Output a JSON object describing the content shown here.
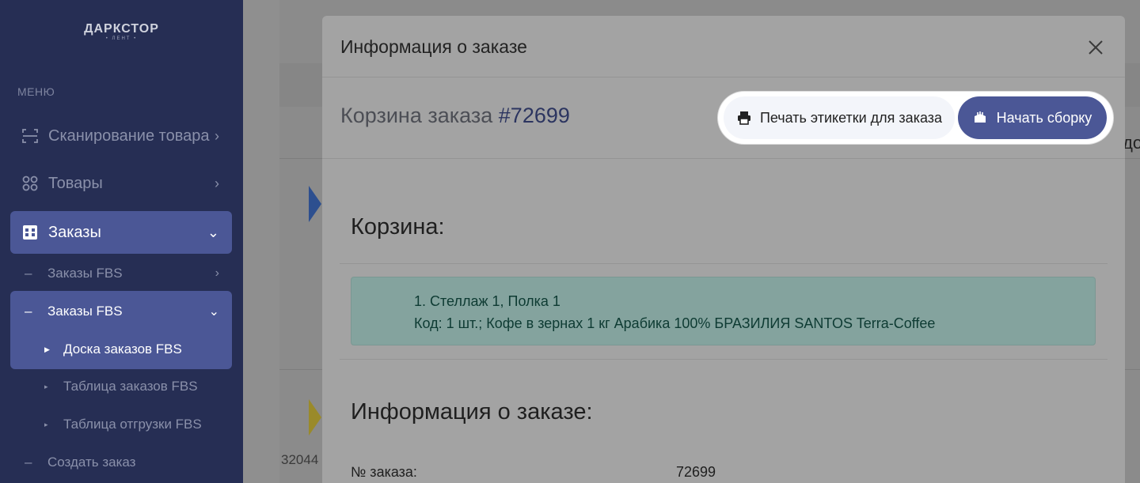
{
  "brand": {
    "name": "ДАРКСТОР",
    "sub": "• ЛЕНТ •"
  },
  "sidebar": {
    "menu_label": "МЕНЮ",
    "items": [
      {
        "label": "Сканирование товара",
        "icon": "scan-icon"
      },
      {
        "label": "Товары",
        "icon": "products-icon"
      },
      {
        "label": "Заказы",
        "icon": "orders-icon"
      }
    ],
    "sub_items": [
      {
        "label": "Заказы FBS"
      },
      {
        "label": "Заказы FBS"
      }
    ],
    "leaves": [
      {
        "label": "Доска заказов FBS"
      },
      {
        "label": "Таблица заказов FBS"
      },
      {
        "label": "Таблица отгрузки FBS"
      }
    ],
    "create_order": "Создать заказ"
  },
  "background": {
    "row_number": "32044",
    "right_text": "до"
  },
  "modal": {
    "title": "Информация о заказе",
    "cart_title_prefix": "Корзина заказа",
    "order_number": "#72699",
    "print_button": "Печать этикетки для заказа",
    "start_button": "Начать сборку",
    "cart_section": "Корзина:",
    "cart_item": {
      "line1": "1. Стеллаж 1, Полка 1",
      "line2": "Код: 1 шт.; Кофе в зернах 1 кг Арабика 100% БРАЗИЛИЯ SANTOS Terra-Coffee"
    },
    "info_section": "Информация о заказе:",
    "info_rows": [
      {
        "label": "№ заказа:",
        "value": "72699"
      }
    ]
  },
  "colors": {
    "sidebar_bg": "#262e54",
    "accent": "#4b5796",
    "item_box": "#84a39e"
  }
}
